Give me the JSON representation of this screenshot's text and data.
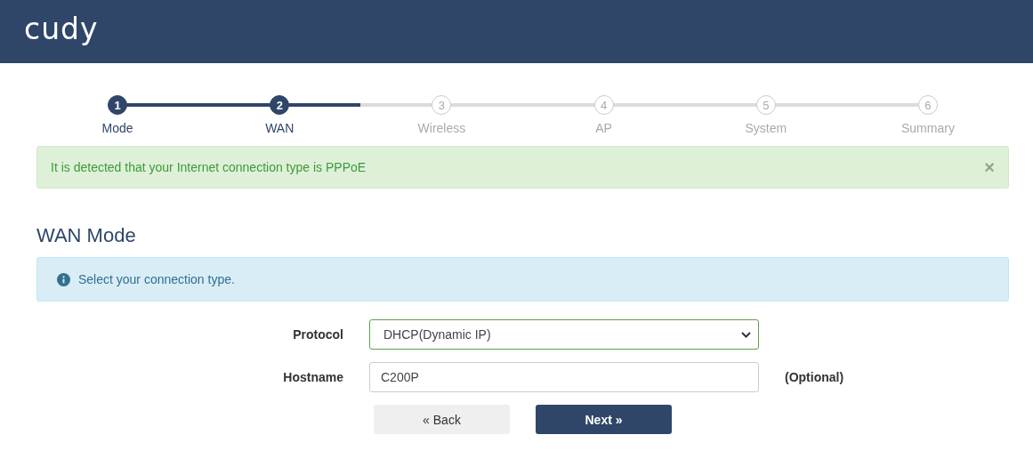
{
  "header": {
    "logo": "cudy"
  },
  "steps": [
    {
      "number": "1",
      "label": "Mode",
      "done": true
    },
    {
      "number": "2",
      "label": "WAN",
      "done": true
    },
    {
      "number": "3",
      "label": "Wireless",
      "done": false
    },
    {
      "number": "4",
      "label": "AP",
      "done": false
    },
    {
      "number": "5",
      "label": "System",
      "done": false
    },
    {
      "number": "6",
      "label": "Summary",
      "done": false
    }
  ],
  "alert": {
    "message": "It is detected that your Internet connection type is PPPoE",
    "close": "×"
  },
  "section_title": "WAN Mode",
  "info": {
    "message": "Select your connection type."
  },
  "form": {
    "fields": [
      {
        "kind": "select",
        "label": "Protocol",
        "value": "DHCP(Dynamic IP)"
      },
      {
        "kind": "text",
        "label": "Hostname",
        "value": "C200P",
        "note": "(Optional)"
      }
    ]
  },
  "buttons": [
    {
      "label": "« Back",
      "kind": "secondary"
    },
    {
      "label": "Next »",
      "kind": "primary"
    }
  ]
}
